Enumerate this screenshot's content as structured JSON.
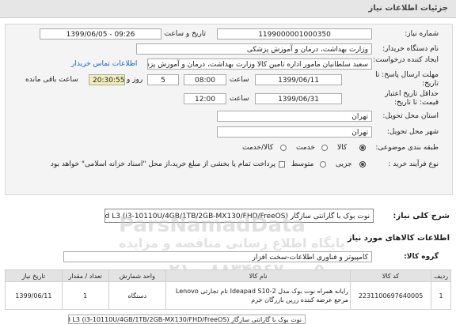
{
  "header": {
    "title": "جزئیات اطلاعات نیاز"
  },
  "form": {
    "need_number_label": "شماره نیاز:",
    "need_number": "1199000001000350",
    "announce_label": "تاریخ و ساعت اعلان عمومی:",
    "announce_value": "1399/06/05 - 09:26",
    "buyer_org_label": "نام دستگاه خریدار:",
    "buyer_org": "وزارت بهداشت، درمان و آموزش پزشکی",
    "creator_label": "ایجاد کننده درخواست:",
    "creator": "سعید سلطانیان مامور اداره تامین کالا وزارت بهداشت، درمان و آموزش پزشکی",
    "contact_link": "اطلاعات تماس خریدار",
    "deadline_label": "مهلت ارسال پاسخ: تا تاریخ:",
    "deadline_date": "1399/06/11",
    "time_label": "ساعت",
    "deadline_time": "08:00",
    "days_value": "5",
    "days_and_label": "روز و",
    "remaining_time": "20:30:55",
    "remaining_label": "ساعت باقی مانده",
    "validity_label": "حداقل تاریخ اعتبار قیمت: تا تاریخ:",
    "validity_date": "1399/06/31",
    "validity_time": "12:00",
    "province_label": "استان محل تحویل:",
    "province": "تهران",
    "city_label": "شهر محل تحویل:",
    "city": "تهران",
    "category_label": "طبقه بندی موضوعی:",
    "category_options": [
      "کالا",
      "خدمت",
      "کالا/خدمت"
    ],
    "purchase_type_label": "نوع فرآیند خرید :",
    "purchase_type_options": [
      "جزیی",
      "متوسط"
    ],
    "payment_note": "پرداخت تمام یا بخشی از مبلغ خرید،از محل \"اسناد خزانه اسلامی\" خواهد بود."
  },
  "summary": {
    "label": "شرح کلی نیاز:",
    "value": "نوت بوک با گارانتی سازگار Lenovo Ideapad L3 (i3-10110U/4GB/1TB/2GB-MX130/FHD/FreeOS)"
  },
  "goods": {
    "title": "اطلاعات کالاهای مورد نیاز",
    "group_label": "گروه کالا:",
    "group_value": "کامپیوتر و فناوری اطلاعات-سخت افزار",
    "columns": [
      "ردیف",
      "کد کالا",
      "نام کالا",
      "واحد شمارش",
      "تعداد / مقدار",
      "تاریخ نیاز"
    ],
    "rows": [
      {
        "index": "1",
        "code": "2231100697640005",
        "name": "رایانه همراه نوت بوک مدل Ideapad S10-2 نام تجارتی Lenovo مرجع عرضه کننده زرین بازرگان خرم",
        "unit": "دستگاه",
        "qty": "1",
        "date": "1399/06/11"
      }
    ],
    "bottom_snippet": "نوت بوک با گارانتی سازگار Lenovo Ideapad L3 (i3-10110U/4GB/1TB/2GB-MX130/FHD/FreeOS)"
  },
  "watermark": {
    "brand": "ParsNamadData",
    "line1": "پایگاه اطلاع رسانی مناقصه و مزایده",
    "phone": "۰۲۱ - ۸۸۳۴۹۶۷۰ - ۵"
  },
  "colors": {
    "timer_bg": "#f3efb4",
    "link": "#1565c0",
    "panel_bg": "#f4f4f4"
  }
}
